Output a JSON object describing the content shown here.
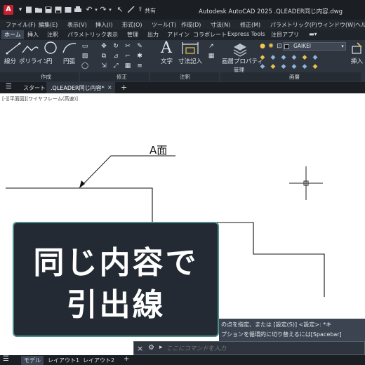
{
  "titlebar": {
    "logo": "A",
    "share_label": "共有",
    "title": "Autodesk AutoCAD 2025    .QLEADER同じ内容.dwg",
    "icons": [
      "new-file-icon",
      "open-folder-icon",
      "save-icon",
      "save-as-icon",
      "print-icon",
      "undo-icon",
      "redo-icon",
      "cursor-icon",
      "measure-icon",
      "share-icon"
    ]
  },
  "menubar": {
    "items": [
      "ファイル(F)",
      "編集(E)",
      "表示(V)",
      "挿入(I)",
      "形式(O)",
      "ツール(T)",
      "作成(D)",
      "寸法(N)",
      "修正(M)",
      "パラメトリック(P)",
      "ウィンドウ(W)",
      "ヘル"
    ]
  },
  "ribbon_tabs": {
    "items": [
      "ホーム",
      "挿入",
      "注釈",
      "パラメトリック",
      "表示",
      "管理",
      "出力",
      "アドイン",
      "コラボレート",
      "Express Tools",
      "注目アプリ"
    ]
  },
  "ribbon": {
    "tools": [
      "線分",
      "ポリライン",
      "円",
      "円弧",
      "文字",
      "寸法記入",
      "画層プロパティ",
      "挿入"
    ],
    "panels": [
      "作成",
      "修正",
      "注釈",
      "画層"
    ],
    "sub_label": "管理",
    "layer_name": "GAIKEI"
  },
  "file_tabs": {
    "start": "スタート",
    "active": ".QLEADER同じ内容*",
    "close": "×",
    "add": "+",
    "menu": "☰"
  },
  "viewport": {
    "label": "[-][平面図][ワイヤフレーム(高速)]",
    "annotation": "A面"
  },
  "caption": {
    "line1": "同じ内容で",
    "line2": "引出線"
  },
  "command_history": {
    "line1": "の点を指定、または [設定(S)] <設定>: *キ",
    "line2": "プションを循環的に切り替えるには[Spacebar]"
  },
  "command_line": {
    "placeholder": "ここにコマンドを入力",
    "close": "×",
    "prompt": "▸"
  },
  "layout_tabs": {
    "items": [
      "モデル",
      "レイアウト1",
      "レイアウト2"
    ],
    "add": "+"
  },
  "colors": {
    "titlebar_bg": "#1b1f24",
    "ribbon_bg": "#2e353e",
    "caption_bg": "#232a34",
    "caption_border": "#4c8f8a",
    "logo_red": "#c8202f"
  }
}
